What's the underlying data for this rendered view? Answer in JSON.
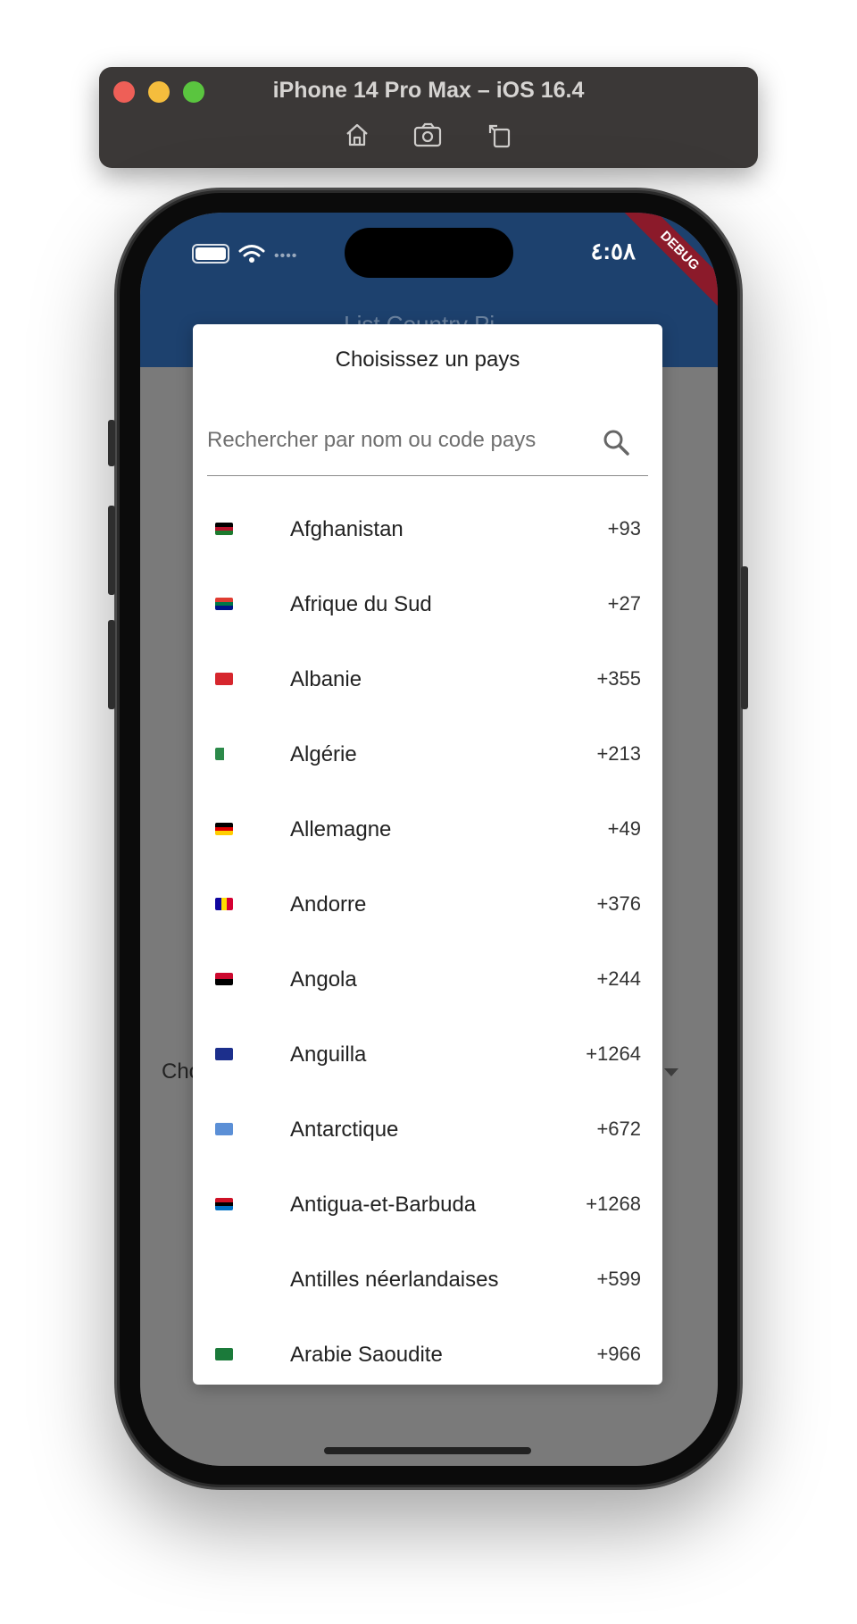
{
  "simulator": {
    "title": "iPhone 14 Pro Max – iOS 16.4",
    "tools": [
      "home-icon",
      "screenshot-icon",
      "rotate-icon"
    ]
  },
  "status_bar": {
    "time": "٤:٥٨",
    "debug_banner": "DEBUG"
  },
  "app": {
    "bar_color": "#1d416e",
    "title": "List Country Pi...",
    "background_label": "Cho"
  },
  "dialog": {
    "title": "Choisissez un pays",
    "search": {
      "placeholder": "Rechercher par nom ou code pays",
      "value": ""
    },
    "countries": [
      {
        "name": "Afghanistan",
        "code": "+93",
        "flag": "af"
      },
      {
        "name": "Afrique du Sud",
        "code": "+27",
        "flag": "za"
      },
      {
        "name": "Albanie",
        "code": "+355",
        "flag": "al"
      },
      {
        "name": "Algérie",
        "code": "+213",
        "flag": "dz"
      },
      {
        "name": "Allemagne",
        "code": "+49",
        "flag": "de"
      },
      {
        "name": "Andorre",
        "code": "+376",
        "flag": "ad"
      },
      {
        "name": "Angola",
        "code": "+244",
        "flag": "ao"
      },
      {
        "name": "Anguilla",
        "code": "+1264",
        "flag": "ai"
      },
      {
        "name": "Antarctique",
        "code": "+672",
        "flag": "aq"
      },
      {
        "name": "Antigua-et-Barbuda",
        "code": "+1268",
        "flag": "ag"
      },
      {
        "name": "Antilles néerlandaises",
        "code": "+599",
        "flag": ""
      },
      {
        "name": "Arabie Saoudite",
        "code": "+966",
        "flag": "sa"
      }
    ]
  }
}
